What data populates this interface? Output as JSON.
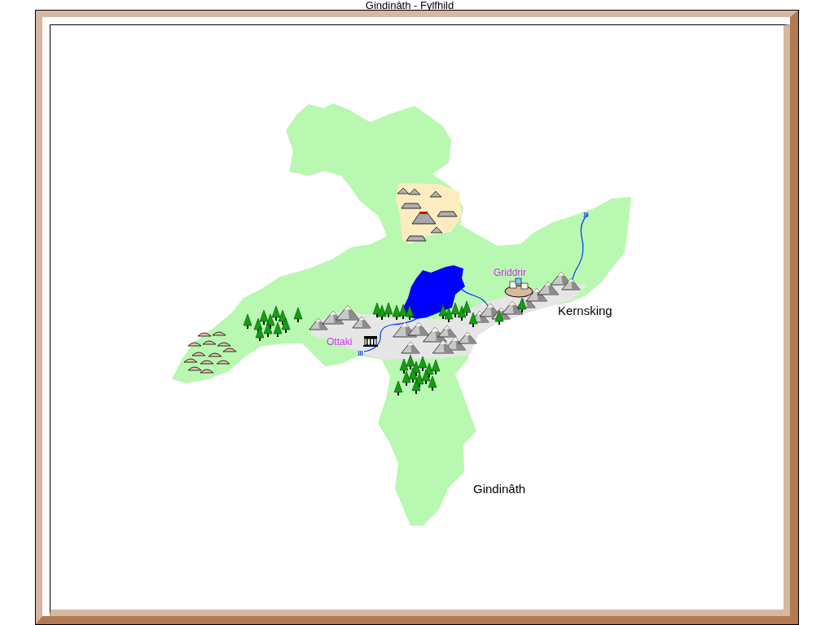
{
  "window": {
    "title": "Gindinâth - Fylfhild"
  },
  "map": {
    "labels": [
      {
        "text": "Griddrir",
        "kind": "town"
      },
      {
        "text": "Kernsking",
        "kind": "region"
      },
      {
        "text": "Ottaki",
        "kind": "town"
      },
      {
        "text": "Gindinâth",
        "kind": "region"
      }
    ]
  }
}
